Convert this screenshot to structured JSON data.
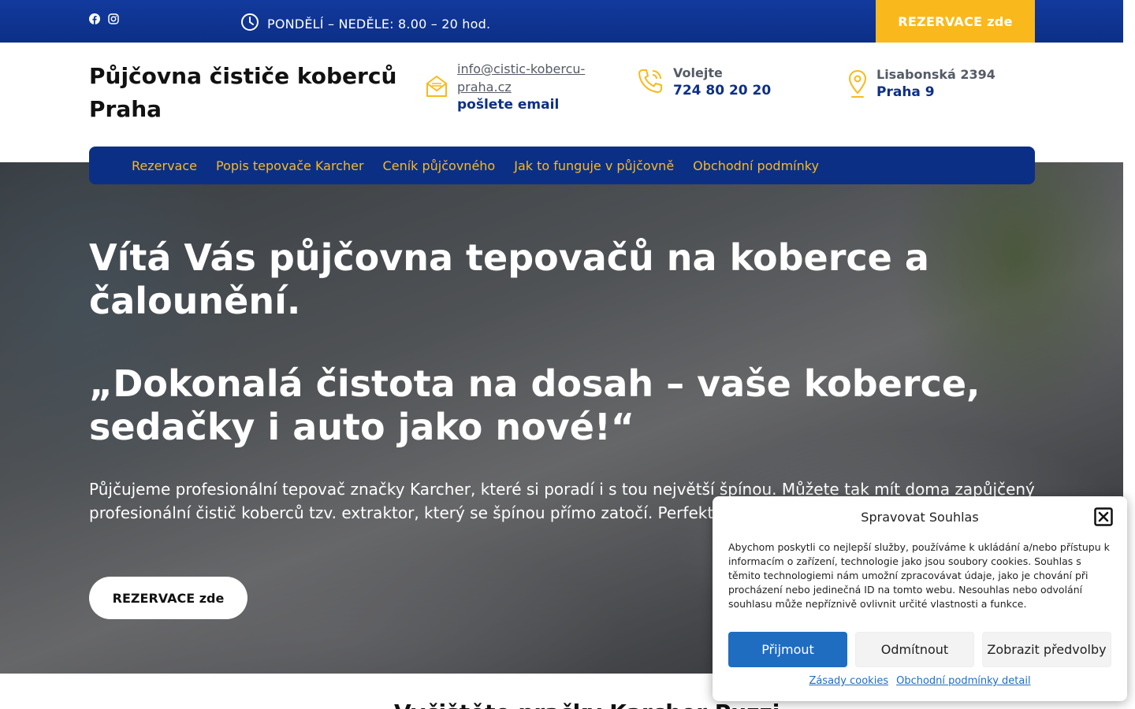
{
  "topbar": {
    "social_icons": [
      "facebook-icon",
      "instagram-icon"
    ],
    "hours": "PONDĚLÍ – NEDĚLE: 8.00 – 20 hod.",
    "cta_label": "REZERVACE zde"
  },
  "header": {
    "site_title": "Půjčovna čističe koberců Praha",
    "email": {
      "address": "info@cistic-kobercu-praha.cz",
      "label": "pošlete email"
    },
    "phone": {
      "label": "Volejte",
      "number": "724 80 20 20"
    },
    "address": {
      "street": "Lisabonská 2394",
      "city": "Praha 9"
    }
  },
  "nav": {
    "items": [
      {
        "label": "Rezervace"
      },
      {
        "label": "Popis tepovače Karcher"
      },
      {
        "label": "Ceník půjčovného"
      },
      {
        "label": "Jak to funguje v půjčovně"
      },
      {
        "label": "Obchodní podmínky"
      }
    ]
  },
  "hero": {
    "title": "Vítá Vás půjčovna tepovačů na koberce a čalounění.",
    "quote": "„Dokonalá čistota na dosah – vaše koberce, sedačky i auto jako nové!“",
    "text": "Půjčujeme profesionální tepovač značky Karcher, které si poradí i s tou největší špínou. Můžete tak mít doma zapůjčený profesionální čistič koberců tzv. extraktor, který se špínou přímo zatočí. Perfektní matrací.",
    "cta_label": "REZERVACE zde"
  },
  "next_section": {
    "heading_partial": "Vyčištěte pračky Karcher Puzzi"
  },
  "cookie": {
    "title": "Spravovat Souhlas",
    "text": "Abychom poskytli co nejlepší služby, používáme k ukládání a/nebo přístupu k informacím o zařízení, technologie jako jsou soubory cookies. Souhlas s těmito technologiemi nám umožní zpracovávat údaje, jako je chování při procházení nebo jedinečná ID na tomto webu. Nesouhlas nebo odvolání souhlasu může nepříznivě ovlivnit určité vlastnosti a funkce.",
    "accept": "Přijmout",
    "deny": "Odmítnout",
    "prefs": "Zobrazit předvolby",
    "links": [
      "Zásady cookies",
      "Obchodní podmínky detail"
    ]
  },
  "colors": {
    "brand_blue": "#0c2f86",
    "accent_yellow": "#f9b91c",
    "accept_blue": "#1f6dc1"
  }
}
